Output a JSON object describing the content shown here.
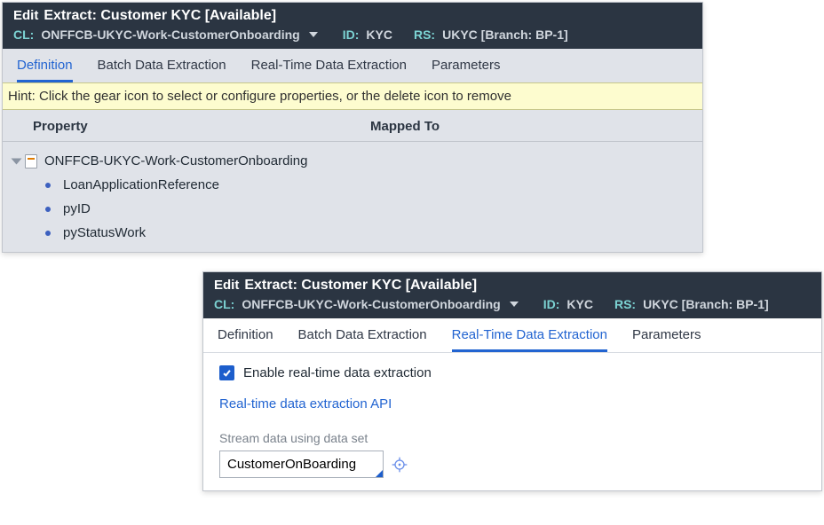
{
  "panel1": {
    "edit": "Edit",
    "title": "Extract: Customer KYC [Available]",
    "cl_label": "CL:",
    "cl_value": "ONFFCB-UKYC-Work-CustomerOnboarding",
    "id_label": "ID:",
    "id_value": "KYC",
    "rs_label": "RS:",
    "rs_value": "UKYC [Branch: BP-1]",
    "tabs": [
      "Definition",
      "Batch Data Extraction",
      "Real-Time Data Extraction",
      "Parameters"
    ],
    "active_tab": 0,
    "hint": "Hint: Click the gear icon to select or configure properties, or the delete icon to remove",
    "col_property": "Property",
    "col_mapped": "Mapped To",
    "root": "ONFFCB-UKYC-Work-CustomerOnboarding",
    "children": [
      "LoanApplicationReference",
      "pyID",
      "pyStatusWork"
    ]
  },
  "panel2": {
    "edit": "Edit",
    "title": "Extract: Customer KYC [Available]",
    "cl_label": "CL:",
    "cl_value": "ONFFCB-UKYC-Work-CustomerOnboarding",
    "id_label": "ID:",
    "id_value": "KYC",
    "rs_label": "RS:",
    "rs_value": "UKYC [Branch: BP-1]",
    "tabs": [
      "Definition",
      "Batch Data Extraction",
      "Real-Time Data Extraction",
      "Parameters"
    ],
    "active_tab": 2,
    "enable_label": "Enable real-time data extraction",
    "enable_checked": true,
    "api_link": "Real-time data extraction API",
    "dataset_label": "Stream data using data set",
    "dataset_value": "CustomerOnBoarding"
  }
}
